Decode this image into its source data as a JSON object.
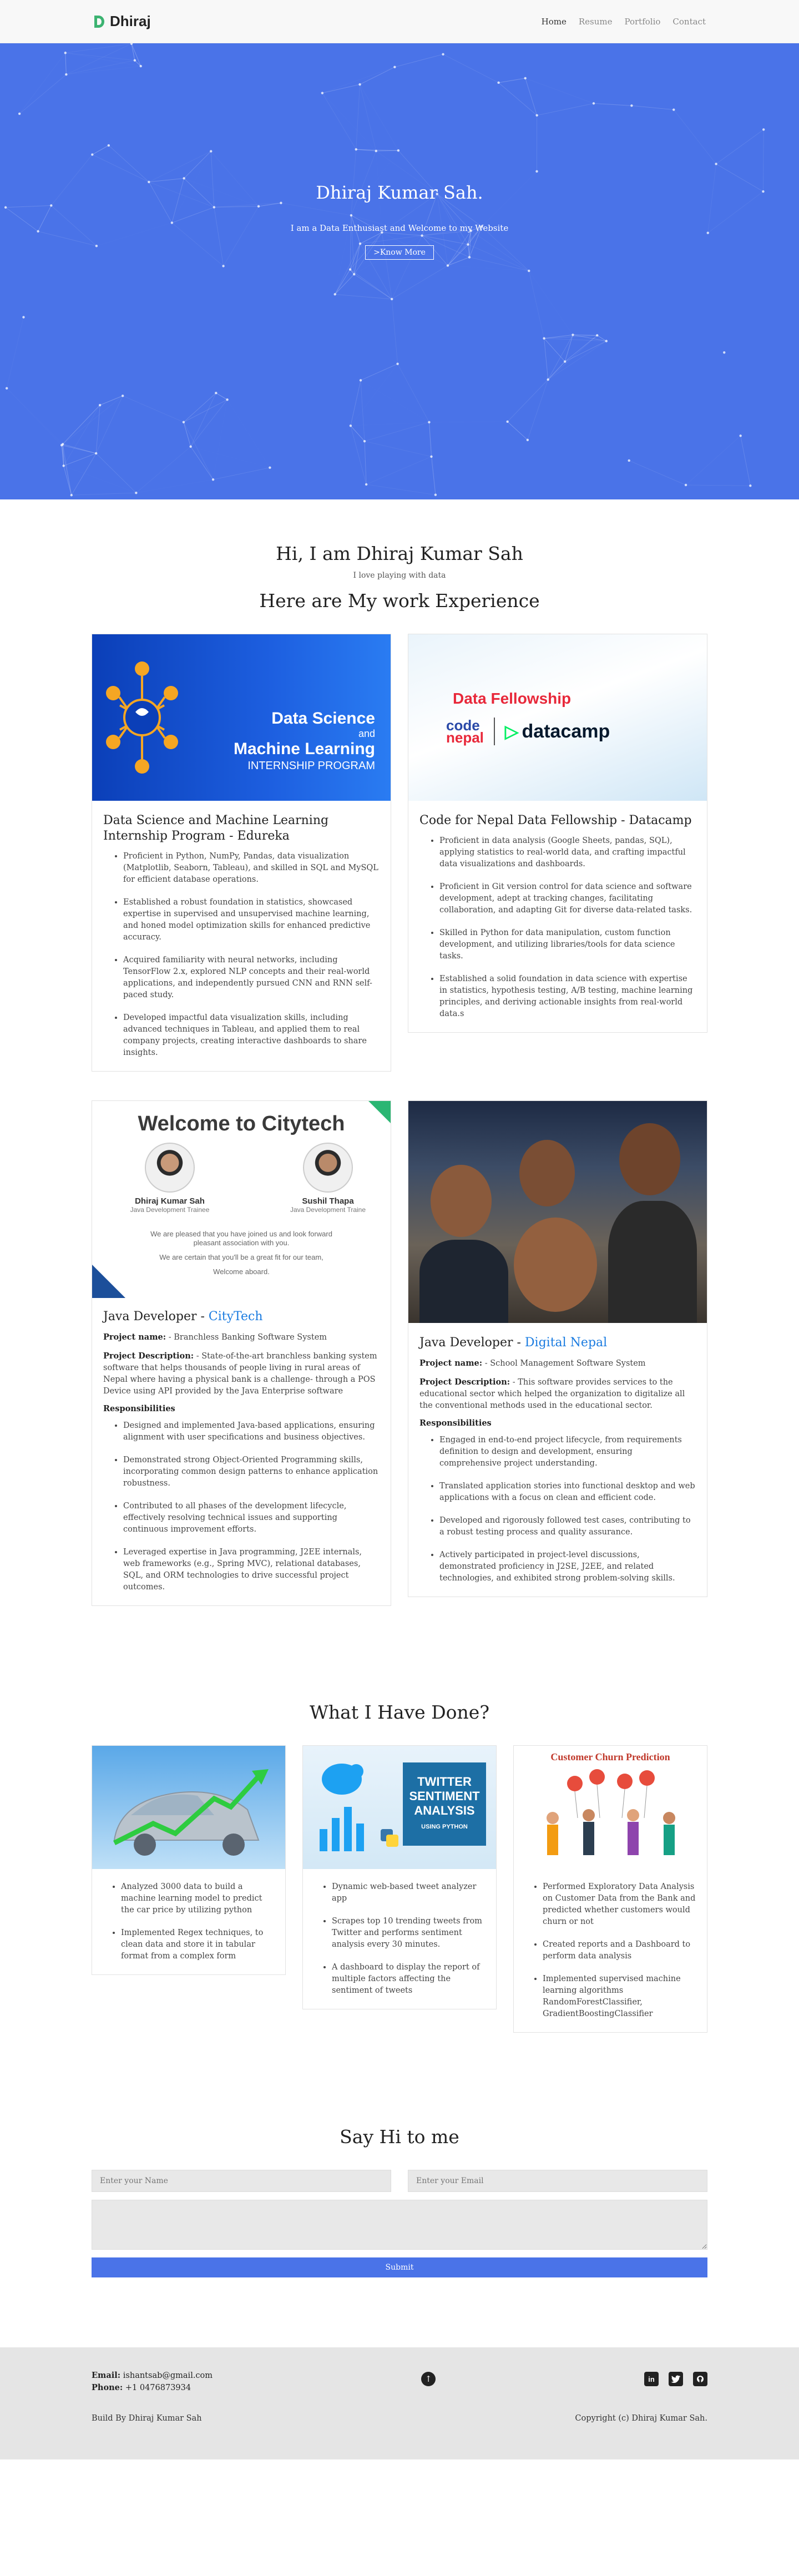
{
  "nav": {
    "brand": "Dhiraj",
    "links": [
      "Home",
      "Resume",
      "Portfolio",
      "Contact"
    ]
  },
  "hero": {
    "name": "Dhiraj Kumar Sah.",
    "tagline": "I am a Data Enthusiast and Welcome to my Website",
    "button": ">Know More"
  },
  "about": {
    "greeting": "Hi, I am Dhiraj Kumar Sah",
    "subtitle": "I love playing with data",
    "experience_heading": "Here are My work Experience"
  },
  "experience": {
    "edureka": {
      "image_title_1": "Data Science",
      "image_title_2": "and",
      "image_title_3": "Machine Learning",
      "image_title_4": "INTERNSHIP PROGRAM",
      "title": "Data Science and Machine Learning Internship Program - Edureka",
      "items": [
        "Proficient in Python, NumPy, Pandas, data visualization (Matplotlib, Seaborn, Tableau), and skilled in SQL and MySQL for efficient database operations.",
        "Established a robust foundation in statistics, showcased expertise in supervised and unsupervised machine learning, and honed model optimization skills for enhanced predictive accuracy.",
        "Acquired familiarity with neural networks, including TensorFlow 2.x, explored NLP concepts and their real-world applications, and independently pursued CNN and RNN self-paced study.",
        "Developed impactful data visualization skills, including advanced techniques in Tableau, and applied them to real company projects, creating interactive dashboards to share insights."
      ]
    },
    "datacamp": {
      "image_heading": "Data Fellowship",
      "logo_code": "code",
      "logo_nepal": "nepal",
      "logo_datacamp": "datacamp",
      "title": "Code for Nepal Data Fellowship - Datacamp",
      "items": [
        "Proficient in data analysis (Google Sheets, pandas, SQL), applying statistics to real-world data, and crafting impactful data visualizations and dashboards.",
        "Proficient in Git version control for data science and software development, adept at tracking changes, facilitating collaboration, and adapting Git for diverse data-related tasks.",
        "Skilled in Python for data manipulation, custom function development, and utilizing libraries/tools for data science tasks.",
        "Established a solid foundation in data science with expertise in statistics, hypothesis testing, A/B testing, machine learning principles, and deriving actionable insights from real-world data.s"
      ]
    },
    "citytech": {
      "image_heading": "Welcome to Citytech",
      "person1_name": "Dhiraj Kumar Sah",
      "person1_role": "Java Development Trainee",
      "person2_name": "Sushil Thapa",
      "person2_role": "Java Development Traine",
      "welcome_line1": "We are pleased that you have joined us and look forward",
      "welcome_line2": "pleasant association with you.",
      "welcome_line3": "We are certain that you'll be a great fit for our team,",
      "welcome_line4": "Welcome aboard.",
      "title_prefix": "Java Developer - ",
      "title_company": "CityTech",
      "project_label": "Project name:",
      "project_name": " - Branchless Banking Software System",
      "desc_label": "Project Description:",
      "desc_text": " - State-of-the-art branchless banking system software that helps thousands of people living in rural areas of Nepal where having a physical bank is a challenge- through a POS Device using API provided by the Java Enterprise software",
      "resp_label": "Responsibilities",
      "items": [
        "Designed and implemented Java-based applications, ensuring alignment with user specifications and business objectives.",
        "Demonstrated strong Object-Oriented Programming skills, incorporating common design patterns to enhance application robustness.",
        "Contributed to all phases of the development lifecycle, effectively resolving technical issues and supporting continuous improvement efforts.",
        "Leveraged expertise in Java programming, J2EE internals, web frameworks (e.g., Spring MVC), relational databases, SQL, and ORM technologies to drive successful project outcomes."
      ]
    },
    "digitalnepal": {
      "title_prefix": "Java Developer - ",
      "title_company": "Digital Nepal",
      "project_label": "Project name:",
      "project_name": " - School Management Software System",
      "desc_label": "Project Description:",
      "desc_text": " - This software provides services to the educational sector which helped the organization to digitalize all the conventional methods used in the educational sector.",
      "resp_label": "Responsibilities",
      "items": [
        "Engaged in end-to-end project lifecycle, from requirements definition to design and development, ensuring comprehensive project understanding.",
        "Translated application stories into functional desktop and web applications with a focus on clean and efficient code.",
        "Developed and rigorously followed test cases, contributing to a robust testing process and quality assurance.",
        "Actively participated in project-level discussions, demonstrated proficiency in J2SE, J2EE, and related technologies, and exhibited strong problem-solving skills."
      ]
    }
  },
  "done": {
    "heading": "What I Have Done?",
    "car": {
      "items": [
        "Analyzed 3000 data to build a machine learning model to predict the car price by utilizing python",
        "Implemented Regex techniques, to clean data and store it in tabular format from a complex form"
      ]
    },
    "twitter": {
      "img_line1": "TWITTER",
      "img_line2": "SENTIMENT",
      "img_line3": "ANALYSIS",
      "img_line4": "USING PYTHON",
      "items": [
        "Dynamic web-based tweet analyzer app",
        "Scrapes top 10 trending tweets from Twitter and performs sentiment analysis every 30 minutes.",
        "A dashboard to display the report of multiple factors affecting the sentiment of tweets"
      ]
    },
    "churn": {
      "img_title": "Customer Churn Prediction",
      "items": [
        "Performed Exploratory Data Analysis on Customer Data from the Bank and predicted whether customers would churn or not",
        "Created reports and a Dashboard to perform data analysis",
        "Implemented supervised machine learning algorithms RandomForestClassifier, GradientBoostingClassifier"
      ]
    }
  },
  "contact": {
    "heading": "Say Hi to me",
    "name_placeholder": "Enter your Name",
    "email_placeholder": "Enter your Email",
    "submit": "Submit"
  },
  "footer": {
    "email_label": "Email:",
    "email": " ishantsab@gmail.com",
    "phone_label": "Phone:",
    "phone": " +1 0476873934",
    "built_by": "Build By Dhiraj Kumar Sah",
    "copyright": "Copyright (c) Dhiraj Kumar Sah."
  }
}
